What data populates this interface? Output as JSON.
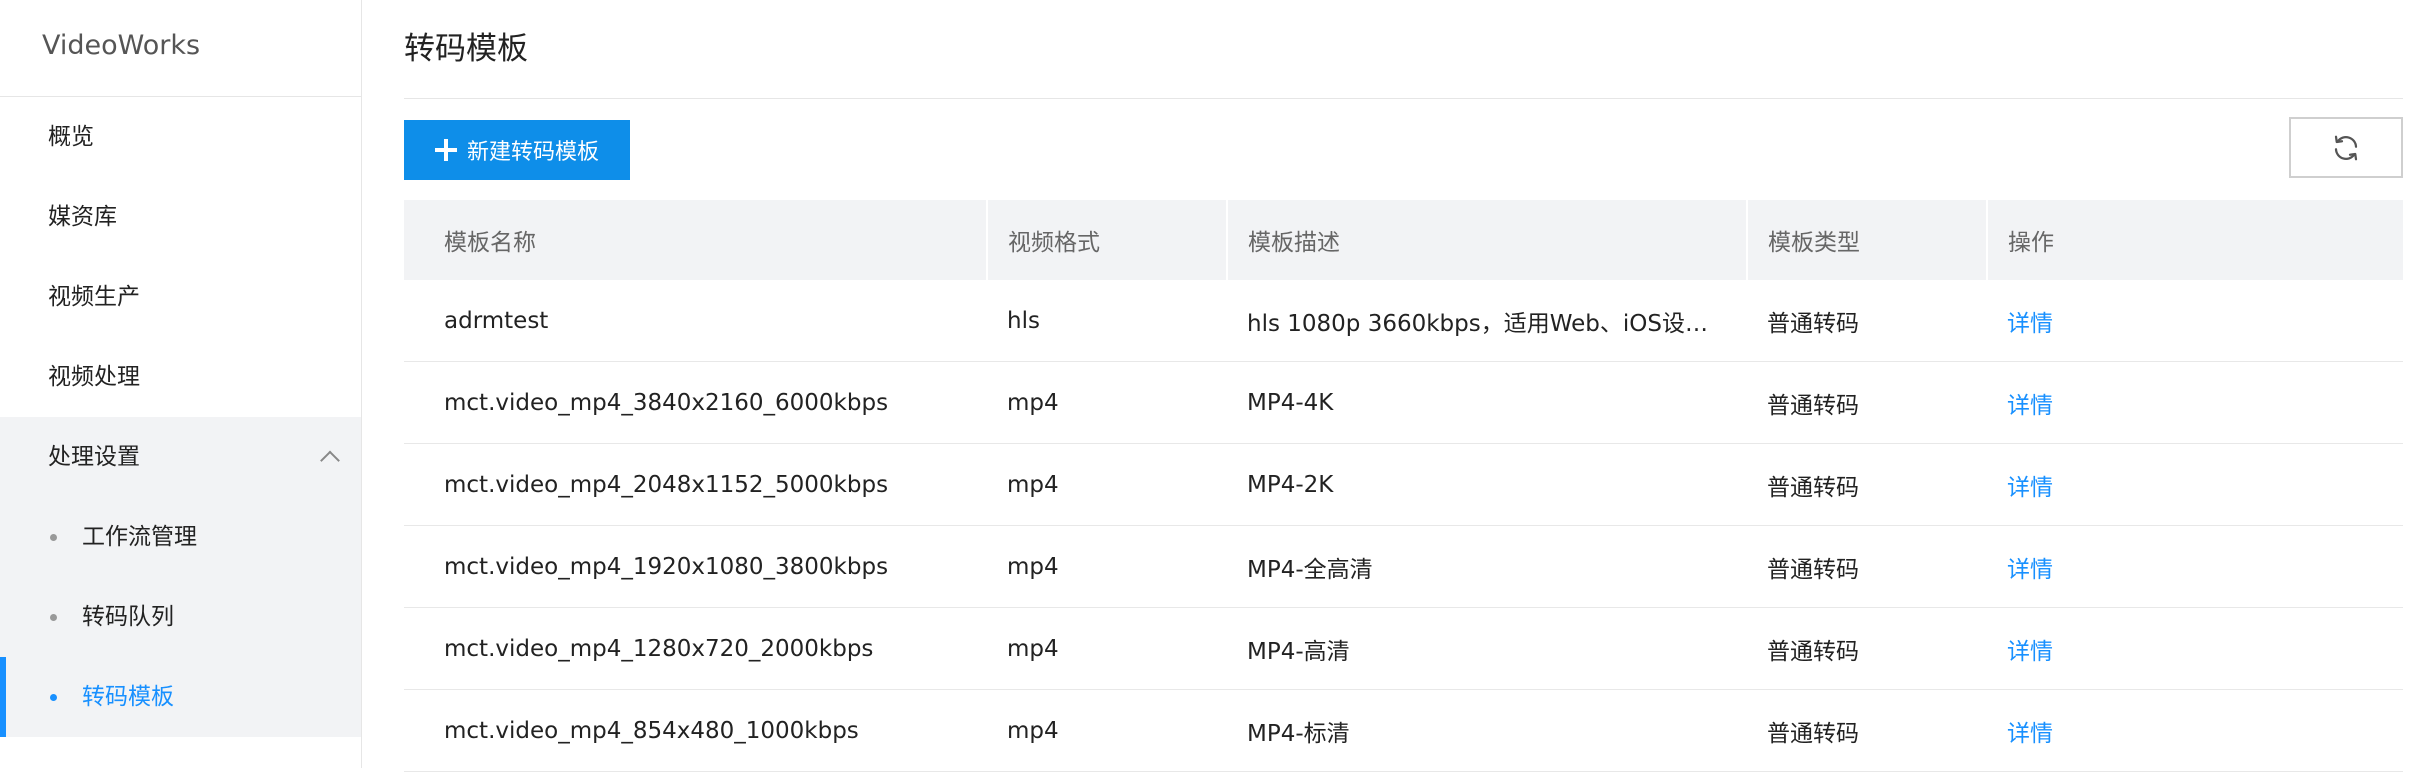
{
  "sidebar": {
    "brand": "VideoWorks",
    "items": [
      {
        "label": "概览"
      },
      {
        "label": "媒资库"
      },
      {
        "label": "视频生产"
      },
      {
        "label": "视频处理"
      }
    ],
    "group": {
      "label": "处理设置",
      "expanded": true,
      "children": [
        {
          "label": "工作流管理",
          "active": false
        },
        {
          "label": "转码队列",
          "active": false
        },
        {
          "label": "转码模板",
          "active": true
        }
      ]
    }
  },
  "main": {
    "title": "转码模板",
    "new_button_label": "新建转码模板",
    "refresh_icon": "refresh-icon",
    "table": {
      "columns": [
        "模板名称",
        "视频格式",
        "模板描述",
        "模板类型",
        "操作"
      ],
      "rows": [
        {
          "name": "adrmtest",
          "format": "hls",
          "description": "hls 1080p 3660kbps，适用Web、iOS设…",
          "type": "普通转码",
          "action": "详情"
        },
        {
          "name": "mct.video_mp4_3840x2160_6000kbps",
          "format": "mp4",
          "description": "MP4-4K",
          "type": "普通转码",
          "action": "详情"
        },
        {
          "name": "mct.video_mp4_2048x1152_5000kbps",
          "format": "mp4",
          "description": "MP4-2K",
          "type": "普通转码",
          "action": "详情"
        },
        {
          "name": "mct.video_mp4_1920x1080_3800kbps",
          "format": "mp4",
          "description": "MP4-全高清",
          "type": "普通转码",
          "action": "详情"
        },
        {
          "name": "mct.video_mp4_1280x720_2000kbps",
          "format": "mp4",
          "description": "MP4-高清",
          "type": "普通转码",
          "action": "详情"
        },
        {
          "name": "mct.video_mp4_854x480_1000kbps",
          "format": "mp4",
          "description": "MP4-标清",
          "type": "普通转码",
          "action": "详情"
        }
      ]
    }
  },
  "colors": {
    "accent": "#0e8ee9",
    "link": "#1890ff",
    "sidebar_group_bg": "#f2f3f5",
    "table_header_bg": "#f2f3f5"
  }
}
